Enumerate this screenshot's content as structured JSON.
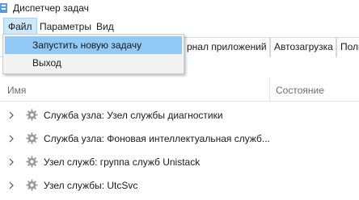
{
  "window": {
    "title": "Диспетчер задач"
  },
  "menu": [
    "Файл",
    "Параметры",
    "Вид"
  ],
  "file_menu": [
    "Запустить новую задачу",
    "Выход"
  ],
  "tabs": [
    "рнал приложений",
    "Автозагрузка",
    "Поль"
  ],
  "columns": {
    "name": "Имя",
    "status": "Состояние"
  },
  "rows": [
    {
      "label": "Служба узла: Узел службы диагностики",
      "icon": "gear-icon"
    },
    {
      "label": "Служба узла: Фоновая интеллектуальная служб...",
      "icon": "gear-icon"
    },
    {
      "label": "Узел служб: группа служб Unistack",
      "icon": "gear-icon"
    },
    {
      "label": "Узел службы: UtcSvc",
      "icon": "gear-icon"
    }
  ],
  "colors": {
    "menu_active_bg": "#cce8ff",
    "dropdown_hover_bg": "#91c9f7",
    "icon_gray": "#9a9a9a"
  }
}
